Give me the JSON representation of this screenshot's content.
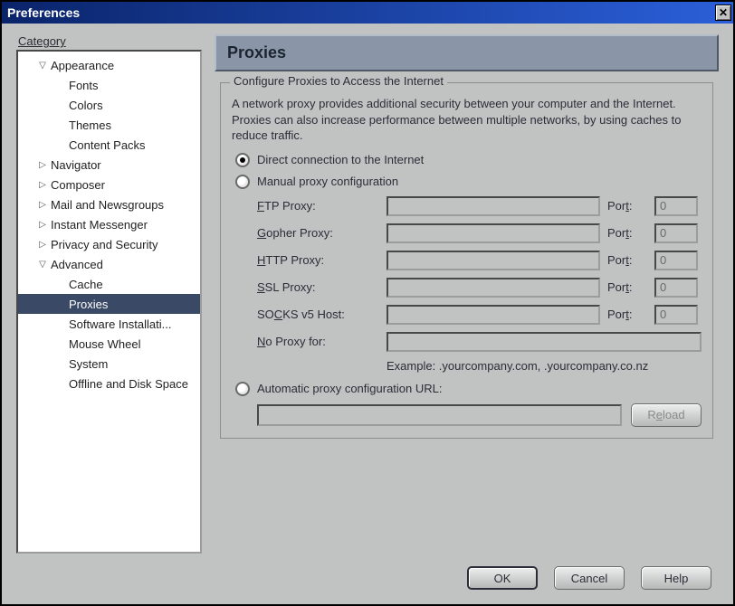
{
  "window": {
    "title": "Preferences",
    "close_glyph": "✕"
  },
  "sidebar": {
    "label": "Category",
    "items": [
      {
        "label": "Appearance",
        "level": 1,
        "expander": "down"
      },
      {
        "label": "Fonts",
        "level": 2
      },
      {
        "label": "Colors",
        "level": 2
      },
      {
        "label": "Themes",
        "level": 2
      },
      {
        "label": "Content Packs",
        "level": 2
      },
      {
        "label": "Navigator",
        "level": 1,
        "expander": "right"
      },
      {
        "label": "Composer",
        "level": 1,
        "expander": "right"
      },
      {
        "label": "Mail and Newsgroups",
        "level": 1,
        "expander": "right"
      },
      {
        "label": "Instant Messenger",
        "level": 1,
        "expander": "right"
      },
      {
        "label": "Privacy and Security",
        "level": 1,
        "expander": "right"
      },
      {
        "label": "Advanced",
        "level": 1,
        "expander": "down"
      },
      {
        "label": "Cache",
        "level": 2
      },
      {
        "label": "Proxies",
        "level": 2,
        "selected": true
      },
      {
        "label": "Software Installati...",
        "level": 2
      },
      {
        "label": "Mouse Wheel",
        "level": 2
      },
      {
        "label": "System",
        "level": 2
      },
      {
        "label": "Offline and Disk Space",
        "level": 2
      }
    ]
  },
  "panel": {
    "title": "Proxies",
    "group_caption": "Configure Proxies to Access the Internet",
    "description": "A network proxy provides additional security between your computer and the Internet. Proxies can also increase performance between multiple networks, by using caches to reduce traffic.",
    "radio_direct": "Direct connection to the Internet",
    "radio_manual": "Manual proxy configuration",
    "radio_auto": "Automatic proxy configuration URL:",
    "selected_radio": "direct",
    "fields": {
      "ftp_u": "F",
      "ftp_rest": "TP Proxy:",
      "gopher_u": "G",
      "gopher_rest": "opher Proxy:",
      "http_u": "H",
      "http_rest": "TTP Proxy:",
      "ssl_u": "S",
      "ssl_rest": "SL Proxy:",
      "socks_pre": "SO",
      "socks_u": "C",
      "socks_rest": "KS v5 Host:",
      "noproxy_u": "N",
      "noproxy_rest": "o Proxy for:",
      "port_pre": "Por",
      "port_u": "t",
      "port_rest": ":",
      "port_value": "0",
      "example": "Example: .yourcompany.com, .yourcompany.co.nz"
    },
    "auto_url": "",
    "reload_pre": "R",
    "reload_u": "e",
    "reload_rest": "load"
  },
  "buttons": {
    "ok": "OK",
    "cancel": "Cancel",
    "help": "Help"
  }
}
